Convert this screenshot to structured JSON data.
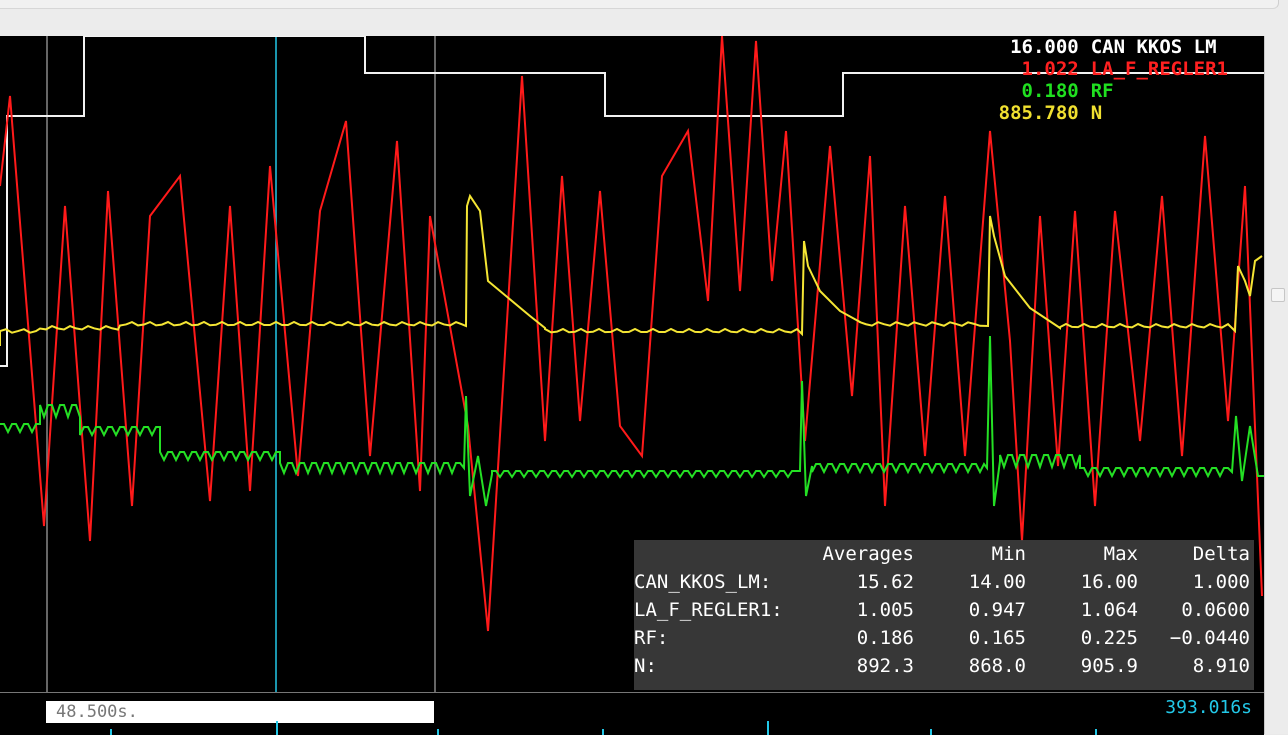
{
  "legend": [
    {
      "value": "16.000",
      "name": "CAN KKOS LM",
      "color": "#ffffff"
    },
    {
      "value": "1.022",
      "name": "LA_F_REGLER1",
      "color": "#ff2020"
    },
    {
      "value": "0.180",
      "name": "RF",
      "color": "#20e020"
    },
    {
      "value": "885.780",
      "name": "N",
      "color": "#f0e030"
    }
  ],
  "stats": {
    "headers": [
      "",
      "Averages",
      "Min",
      "Max",
      "Delta"
    ],
    "rows": [
      [
        "CAN_KKOS_LM:",
        "15.62",
        "14.00",
        "16.00",
        "1.000"
      ],
      [
        "LA_F_REGLER1:",
        "1.005",
        "0.947",
        "1.064",
        "0.0600"
      ],
      [
        "RF:",
        "0.186",
        "0.165",
        "0.225",
        "−0.0440"
      ],
      [
        "N:",
        "892.3",
        "868.0",
        "905.9",
        "8.910"
      ]
    ]
  },
  "timeline": {
    "cursor_time": "48.500s.",
    "end_time": "393.016s"
  },
  "colors": {
    "background": "#000000",
    "cursor": "#22c8e8",
    "grid": "#888888"
  }
}
